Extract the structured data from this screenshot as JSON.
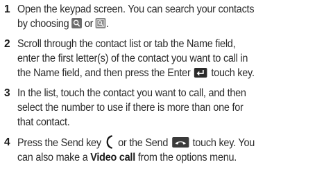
{
  "steps": [
    {
      "number": "1",
      "line1": "Open the keypad screen. You can search your contacts",
      "line2_a": "by choosing",
      "line2_b": "or",
      "line2_c": ".",
      "icons": [
        "search-contacts-icon",
        "search-contacts-alt-icon"
      ]
    },
    {
      "number": "2",
      "line1": "Scroll through the contact list or tab the Name field,",
      "line2": "enter the first letter(s) of the contact you want to call in",
      "line3_a": "the Name field, and then press the Enter",
      "line3_b": "touch key.",
      "icons": [
        "enter-key-icon"
      ]
    },
    {
      "number": "3",
      "line1": "In the list, touch the contact you want to call, and then",
      "line2": "select the number to use if there is more than one for",
      "line3": "that contact."
    },
    {
      "number": "4",
      "line1_a": "Press the Send key",
      "line1_b": "or the Send",
      "line1_c": "touch key. You",
      "line2_a": "can also make a",
      "line2_bold": "Video call",
      "line2_b": "from the options menu.",
      "icons": [
        "send-key-icon",
        "send-touch-key-icon"
      ]
    }
  ]
}
